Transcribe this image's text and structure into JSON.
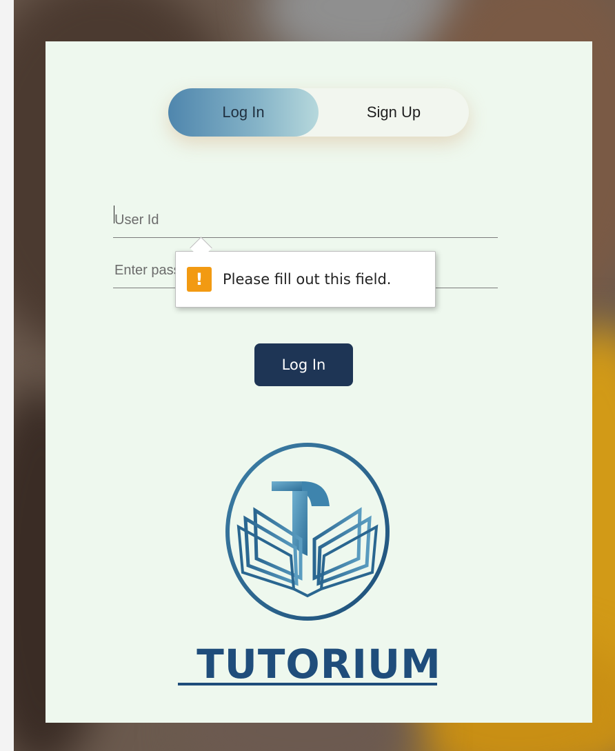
{
  "tabs": {
    "login_label": "Log In",
    "signup_label": "Sign Up"
  },
  "form": {
    "userid_placeholder": "User Id",
    "password_placeholder": "Enter password",
    "submit_label": "Log In"
  },
  "validation": {
    "message": "Please fill out this field.",
    "icon_glyph": "!"
  },
  "brand": {
    "name": "TUTORIUM"
  },
  "colors": {
    "card_bg": "#eef8ee",
    "button_bg": "#1e3555",
    "brand_blue": "#1f4d7b",
    "warning": "#f29a12"
  },
  "icons": {
    "warning": "warning-icon",
    "logo": "open-book-t-logo-icon"
  }
}
